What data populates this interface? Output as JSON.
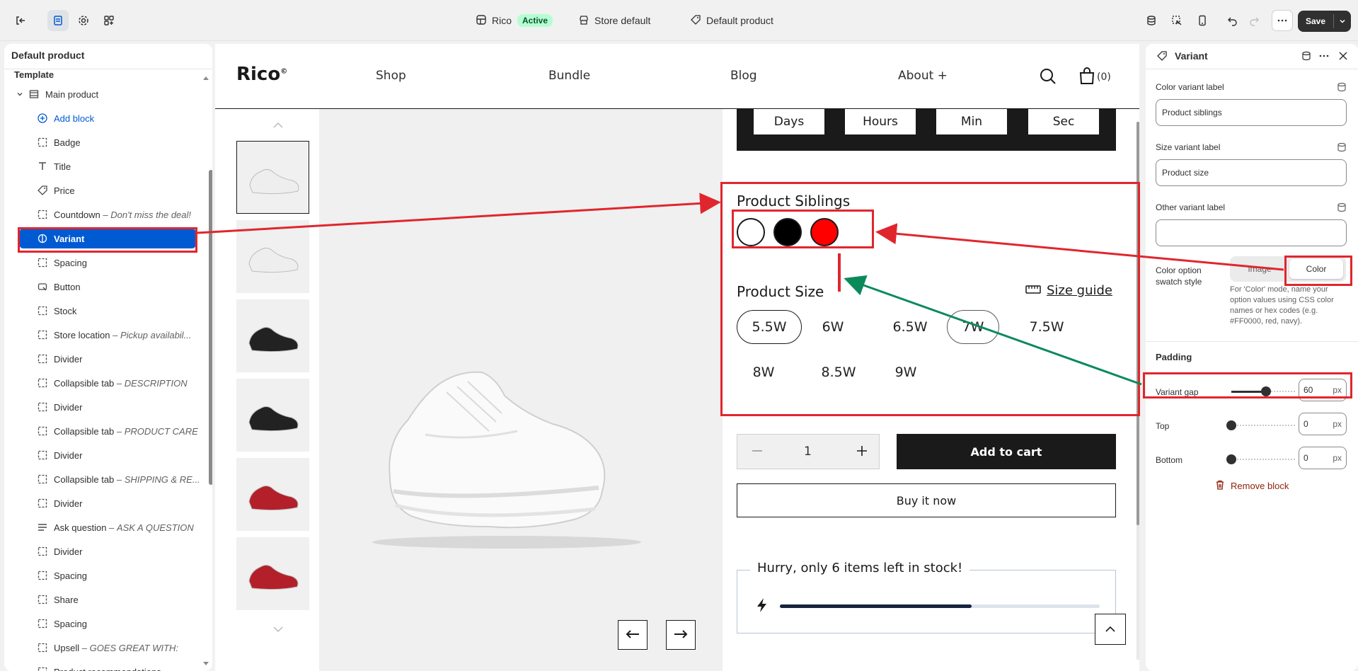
{
  "topbar": {
    "store_name": "Rico",
    "store_status": "Active",
    "store_default": "Store default",
    "template_name": "Default product",
    "save_label": "Save"
  },
  "sidebar": {
    "title": "Default product",
    "template_heading": "Template",
    "section_label": "Main product",
    "add_block": "Add block",
    "items": [
      {
        "label": "Badge",
        "icon": "block-icon",
        "note": ""
      },
      {
        "label": "Title",
        "icon": "text-icon",
        "note": ""
      },
      {
        "label": "Price",
        "icon": "price-tag-icon",
        "note": ""
      },
      {
        "label": "Countdown",
        "icon": "block-icon",
        "note": "Don't miss the deal!"
      },
      {
        "label": "Variant",
        "icon": "variant-icon",
        "note": ""
      },
      {
        "label": "Spacing",
        "icon": "block-icon",
        "note": ""
      },
      {
        "label": "Button",
        "icon": "button-icon",
        "note": ""
      },
      {
        "label": "Stock",
        "icon": "block-icon",
        "note": ""
      },
      {
        "label": "Store location",
        "icon": "block-icon",
        "note": "Pickup availabil..."
      },
      {
        "label": "Divider",
        "icon": "block-icon",
        "note": ""
      },
      {
        "label": "Collapsible tab",
        "icon": "block-icon",
        "note": "DESCRIPTION"
      },
      {
        "label": "Divider",
        "icon": "block-icon",
        "note": ""
      },
      {
        "label": "Collapsible tab",
        "icon": "block-icon",
        "note": "PRODUCT CARE"
      },
      {
        "label": "Divider",
        "icon": "block-icon",
        "note": ""
      },
      {
        "label": "Collapsible tab",
        "icon": "block-icon",
        "note": "SHIPPING & RE..."
      },
      {
        "label": "Divider",
        "icon": "block-icon",
        "note": ""
      },
      {
        "label": "Ask question",
        "icon": "lines-icon",
        "note": "ASK A QUESTION"
      },
      {
        "label": "Divider",
        "icon": "block-icon",
        "note": ""
      },
      {
        "label": "Spacing",
        "icon": "block-icon",
        "note": ""
      },
      {
        "label": "Share",
        "icon": "block-icon",
        "note": ""
      },
      {
        "label": "Spacing",
        "icon": "block-icon",
        "note": ""
      },
      {
        "label": "Upsell",
        "icon": "block-icon",
        "note": "GOES GREAT WITH:"
      },
      {
        "label": "Product recommendations",
        "icon": "block-icon",
        "note": ""
      }
    ],
    "selected_label": "Variant",
    "dash": " – "
  },
  "preview": {
    "logo": "Rico",
    "logo_mark": "©",
    "nav": [
      "Shop",
      "Bundle",
      "Blog",
      "About +"
    ],
    "cart_count": "(0)",
    "countdown": [
      "Days",
      "Hours",
      "Min",
      "Sec"
    ],
    "siblings_title": "Product Siblings",
    "swatches": [
      {
        "name": "white",
        "color": "#ffffff"
      },
      {
        "name": "black",
        "color": "#000000"
      },
      {
        "name": "red",
        "color": "#ff0000"
      }
    ],
    "size_title": "Product Size",
    "size_guide": "Size guide",
    "sizes_row1": [
      "5.5W",
      "6W",
      "6.5W",
      "7W",
      "7.5W"
    ],
    "sizes_row2": [
      "8W",
      "8.5W",
      "9W"
    ],
    "selected_size": "5.5W",
    "quantity": "1",
    "add_to_cart": "Add to cart",
    "buy_now": "Buy it now",
    "stock_text": "Hurry, only 6 items left in stock!",
    "stock_fraction": 0.6,
    "thumbnails": [
      {
        "name": "white-shoe-side",
        "color": "#eeeeee"
      },
      {
        "name": "white-shoe-top",
        "color": "#eeeeee"
      },
      {
        "name": "black-shoe-side",
        "color": "#222222"
      },
      {
        "name": "black-shoe-angle",
        "color": "#222222"
      },
      {
        "name": "red-shoe-side",
        "color": "#b3202a"
      },
      {
        "name": "red-shoe-front",
        "color": "#b3202a"
      }
    ]
  },
  "settings": {
    "title": "Variant",
    "color_label": "Color variant label",
    "color_value": "Product siblings",
    "size_label": "Size variant label",
    "size_value": "Product size",
    "other_label": "Other variant label",
    "other_value": "",
    "swatch_label": "Color option swatch style",
    "swatch_options": [
      "Image",
      "Color"
    ],
    "swatch_selected": "Color",
    "swatch_help": "For 'Color' mode, name your option values using CSS color names or hex codes (e.g. #FF0000, red, navy).",
    "padding_heading": "Padding",
    "sliders": [
      {
        "label": "Variant gap",
        "value": "60",
        "unit": "px",
        "fraction": 0.54
      },
      {
        "label": "Top",
        "value": "0",
        "unit": "px",
        "fraction": 0
      },
      {
        "label": "Bottom",
        "value": "0",
        "unit": "px",
        "fraction": 0
      }
    ],
    "remove_block": "Remove block"
  },
  "colors": {
    "annotation_red": "#e0262d",
    "annotation_green": "#0a8a5a",
    "selected_blue": "#005bd3",
    "active_badge": "#b4fed2"
  }
}
